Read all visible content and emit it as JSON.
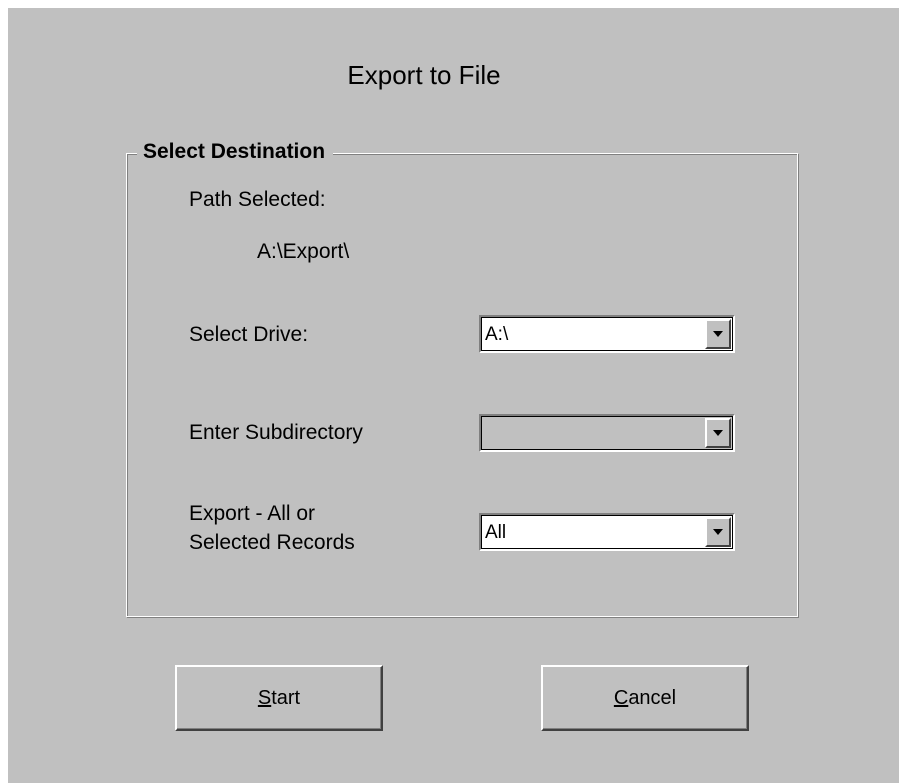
{
  "dialog": {
    "title": "Export to File"
  },
  "group": {
    "legend": "Select Destination",
    "path_label": "Path Selected:",
    "path_value": "A:\\Export\\",
    "drive_label": "Select Drive:",
    "drive_value": "A:\\",
    "subdir_label": "Enter Subdirectory",
    "subdir_value": "",
    "export_label_line1": "Export - All or",
    "export_label_line2": "Selected Records",
    "export_value": "All"
  },
  "buttons": {
    "start_mnemonic": "S",
    "start_rest": "tart",
    "cancel_mnemonic": "C",
    "cancel_rest": "ancel"
  },
  "icons": {
    "dropdown": "chevron-down-icon"
  }
}
